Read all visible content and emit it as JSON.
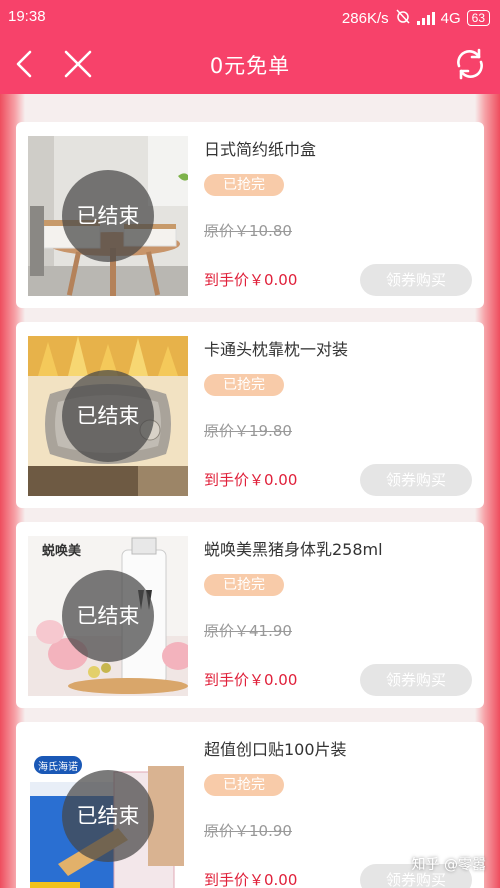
{
  "status": {
    "time": "19:38",
    "net_speed": "286K/s",
    "network": "4G",
    "battery": "63"
  },
  "nav": {
    "title": "0元免单",
    "back_icon": "chevron-left-icon",
    "close_icon": "close-icon",
    "refresh_icon": "refresh-icon"
  },
  "products": [
    {
      "name": "日式简约纸巾盒",
      "badge": "已抢完",
      "ended": "已结束",
      "original_price": "原价￥10.80",
      "final_price": "到手价￥0.00",
      "button": "领券购买"
    },
    {
      "name": "卡通头枕靠枕一对装",
      "badge": "已抢完",
      "ended": "已结束",
      "original_price": "原价￥19.80",
      "final_price": "到手价￥0.00",
      "button": "领券购买"
    },
    {
      "name": "蜕唤美黑猪身体乳258ml",
      "badge": "已抢完",
      "ended": "已结束",
      "original_price": "原价￥41.90",
      "final_price": "到手价￥0.00",
      "button": "领券购买",
      "image_text": "蜕唤美"
    },
    {
      "name": "超值创口贴100片装",
      "badge": "已抢完",
      "ended": "已结束",
      "original_price": "原价￥10.90",
      "final_price": "到手价￥0.00",
      "button": "领券购买",
      "image_text": "海氏海诺"
    }
  ],
  "watermark": "知乎 @零嚣",
  "colors": {
    "header": "#f7426a",
    "price": "#e0203a",
    "badge": "#f8cba9",
    "button": "#e5e5e5"
  }
}
